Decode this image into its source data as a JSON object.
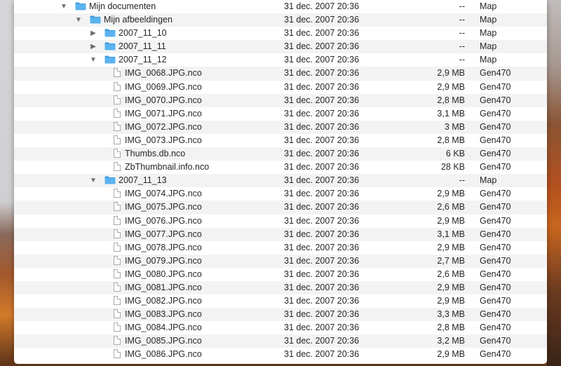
{
  "colors": {
    "folder": "#5ab3ef",
    "folder_tab": "#3e9be0",
    "stripe": "#f3f3f4"
  },
  "rows": [
    {
      "type": "folder",
      "indent": 0,
      "expanded": true,
      "name": "Mijn documenten",
      "date": "31 dec. 2007 20:36",
      "size": "--",
      "kind": "Map"
    },
    {
      "type": "folder",
      "indent": 1,
      "expanded": true,
      "name": "Mijn afbeeldingen",
      "date": "31 dec. 2007 20:36",
      "size": "--",
      "kind": "Map"
    },
    {
      "type": "folder",
      "indent": 2,
      "expanded": false,
      "name": "2007_11_10",
      "date": "31 dec. 2007 20:36",
      "size": "--",
      "kind": "Map"
    },
    {
      "type": "folder",
      "indent": 2,
      "expanded": false,
      "name": "2007_11_11",
      "date": "31 dec. 2007 20:36",
      "size": "--",
      "kind": "Map"
    },
    {
      "type": "folder",
      "indent": 2,
      "expanded": true,
      "name": "2007_11_12",
      "date": "31 dec. 2007 20:36",
      "size": "--",
      "kind": "Map"
    },
    {
      "type": "file",
      "indent": 3,
      "name": "IMG_0068.JPG.nco",
      "date": "31 dec. 2007 20:36",
      "size": "2,9 MB",
      "kind": "Gen470"
    },
    {
      "type": "file",
      "indent": 3,
      "name": "IMG_0069.JPG.nco",
      "date": "31 dec. 2007 20:36",
      "size": "2,9 MB",
      "kind": "Gen470"
    },
    {
      "type": "file",
      "indent": 3,
      "name": "IMG_0070.JPG.nco",
      "date": "31 dec. 2007 20:36",
      "size": "2,8 MB",
      "kind": "Gen470"
    },
    {
      "type": "file",
      "indent": 3,
      "name": "IMG_0071.JPG.nco",
      "date": "31 dec. 2007 20:36",
      "size": "3,1 MB",
      "kind": "Gen470"
    },
    {
      "type": "file",
      "indent": 3,
      "name": "IMG_0072.JPG.nco",
      "date": "31 dec. 2007 20:36",
      "size": "3 MB",
      "kind": "Gen470"
    },
    {
      "type": "file",
      "indent": 3,
      "name": "IMG_0073.JPG.nco",
      "date": "31 dec. 2007 20:36",
      "size": "2,8 MB",
      "kind": "Gen470"
    },
    {
      "type": "file",
      "indent": 3,
      "name": "Thumbs.db.nco",
      "date": "31 dec. 2007 20:36",
      "size": "6 KB",
      "kind": "Gen470"
    },
    {
      "type": "file",
      "indent": 3,
      "name": "ZbThumbnail.info.nco",
      "date": "31 dec. 2007 20:36",
      "size": "28 KB",
      "kind": "Gen470"
    },
    {
      "type": "folder",
      "indent": 2,
      "expanded": true,
      "name": "2007_11_13",
      "date": "31 dec. 2007 20:36",
      "size": "--",
      "kind": "Map"
    },
    {
      "type": "file",
      "indent": 3,
      "name": "IMG_0074.JPG.nco",
      "date": "31 dec. 2007 20:36",
      "size": "2,9 MB",
      "kind": "Gen470"
    },
    {
      "type": "file",
      "indent": 3,
      "name": "IMG_0075.JPG.nco",
      "date": "31 dec. 2007 20:36",
      "size": "2,6 MB",
      "kind": "Gen470"
    },
    {
      "type": "file",
      "indent": 3,
      "name": "IMG_0076.JPG.nco",
      "date": "31 dec. 2007 20:36",
      "size": "2,9 MB",
      "kind": "Gen470"
    },
    {
      "type": "file",
      "indent": 3,
      "name": "IMG_0077.JPG.nco",
      "date": "31 dec. 2007 20:36",
      "size": "3,1 MB",
      "kind": "Gen470"
    },
    {
      "type": "file",
      "indent": 3,
      "name": "IMG_0078.JPG.nco",
      "date": "31 dec. 2007 20:36",
      "size": "2,9 MB",
      "kind": "Gen470"
    },
    {
      "type": "file",
      "indent": 3,
      "name": "IMG_0079.JPG.nco",
      "date": "31 dec. 2007 20:36",
      "size": "2,7 MB",
      "kind": "Gen470"
    },
    {
      "type": "file",
      "indent": 3,
      "name": "IMG_0080.JPG.nco",
      "date": "31 dec. 2007 20:36",
      "size": "2,6 MB",
      "kind": "Gen470"
    },
    {
      "type": "file",
      "indent": 3,
      "name": "IMG_0081.JPG.nco",
      "date": "31 dec. 2007 20:36",
      "size": "2,9 MB",
      "kind": "Gen470"
    },
    {
      "type": "file",
      "indent": 3,
      "name": "IMG_0082.JPG.nco",
      "date": "31 dec. 2007 20:36",
      "size": "2,9 MB",
      "kind": "Gen470"
    },
    {
      "type": "file",
      "indent": 3,
      "name": "IMG_0083.JPG.nco",
      "date": "31 dec. 2007 20:36",
      "size": "3,3 MB",
      "kind": "Gen470"
    },
    {
      "type": "file",
      "indent": 3,
      "name": "IMG_0084.JPG.nco",
      "date": "31 dec. 2007 20:36",
      "size": "2,8 MB",
      "kind": "Gen470"
    },
    {
      "type": "file",
      "indent": 3,
      "name": "IMG_0085.JPG.nco",
      "date": "31 dec. 2007 20:36",
      "size": "3,2 MB",
      "kind": "Gen470"
    },
    {
      "type": "file",
      "indent": 3,
      "name": "IMG_0086.JPG.nco",
      "date": "31 dec. 2007 20:36",
      "size": "2,9 MB",
      "kind": "Gen470"
    }
  ]
}
